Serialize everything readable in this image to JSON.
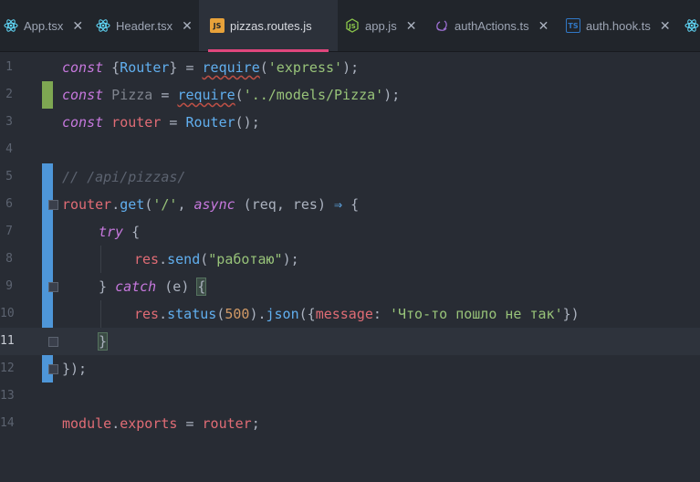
{
  "tabs": [
    {
      "label": "App.tsx",
      "icon": "react-icon",
      "color": "#61dafb"
    },
    {
      "label": "Header.tsx",
      "icon": "react-icon",
      "color": "#61dafb"
    },
    {
      "label": "pizzas.routes.js",
      "icon": "js-file-icon",
      "color": "#e8a23a",
      "active": true
    },
    {
      "label": "app.js",
      "icon": "nodejs-icon",
      "color": "#8cc84b"
    },
    {
      "label": "authActions.ts",
      "icon": "redux-icon",
      "color": "#764abc"
    },
    {
      "label": "auth.hook.ts",
      "icon": "ts-file-icon",
      "color": "#3178c6"
    }
  ],
  "editor": {
    "line_numbers": [
      "1",
      "2",
      "3",
      "4",
      "5",
      "6",
      "7",
      "8",
      "9",
      "10",
      "11",
      "12",
      "13",
      "14"
    ],
    "current_line": "11",
    "lines": {
      "l1": [
        "const",
        " {",
        "Router",
        "} = ",
        "require",
        "(",
        "'express'",
        ");"
      ],
      "l2": [
        "const",
        " Pizza",
        " = ",
        "require",
        "(",
        "'../models/Pizza'",
        ");"
      ],
      "l3": [
        "const",
        " router",
        " = ",
        "Router",
        "();"
      ],
      "l5": [
        "// /api/pizzas/"
      ],
      "l6": [
        "router",
        ".",
        "get",
        "(",
        "'/'",
        ", ",
        "async",
        " (",
        "req",
        ", ",
        "res",
        ") ",
        "⇒",
        " {"
      ],
      "l7": [
        "try",
        " {"
      ],
      "l8": [
        "res",
        ".",
        "send",
        "(",
        "\"работаю\"",
        ");"
      ],
      "l9": [
        "} ",
        "catch",
        " (",
        "e",
        ") ",
        "{"
      ],
      "l10": [
        "res",
        ".",
        "status",
        "(",
        "500",
        ").",
        "json",
        "({",
        "message",
        ": ",
        "'Что-то пошло не так'",
        "})"
      ],
      "l11": [
        "}"
      ],
      "l12": [
        "});"
      ],
      "l14": [
        "module",
        ".",
        "exports",
        " = ",
        "router",
        ";"
      ]
    }
  }
}
